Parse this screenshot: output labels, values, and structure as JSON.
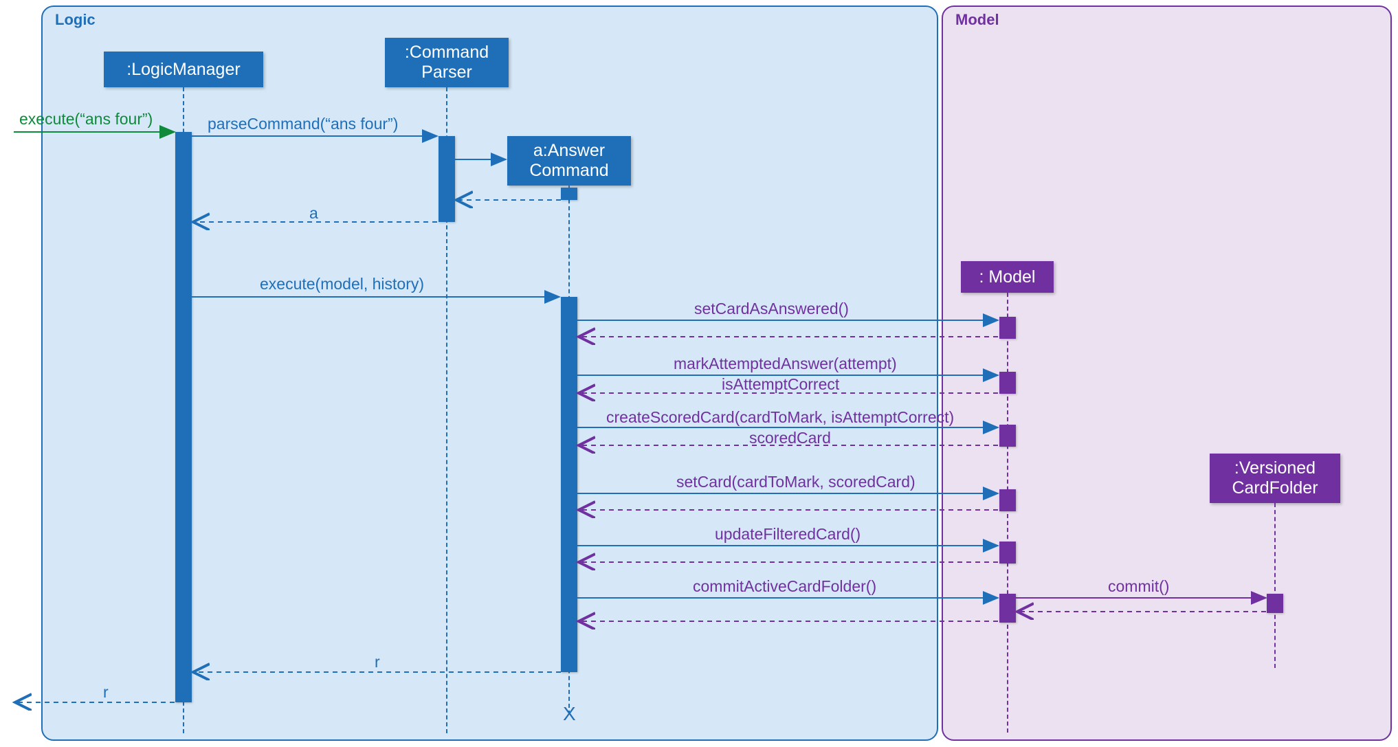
{
  "containers": {
    "logic": {
      "label": "Logic"
    },
    "model": {
      "label": "Model"
    }
  },
  "lifelines": {
    "logicManager": ":LogicManager",
    "commandParser": ":Command\nParser",
    "answerCommand": "a:Answer\nCommand",
    "model": ": Model",
    "versionedCardFolder": ":Versioned\nCardFolder"
  },
  "messages": {
    "executeAnsFour": "execute(“ans four”)",
    "parseCommand": "parseCommand(“ans four”)",
    "returnA": "a",
    "executeModelHistory": "execute(model, history)",
    "setCardAsAnswered": "setCardAsAnswered()",
    "markAttemptedAnswer": "markAttemptedAnswer(attempt)",
    "isAttemptCorrect": "isAttemptCorrect",
    "createScoredCard": "createScoredCard(cardToMark, isAttemptCorrect)",
    "scoredCard": "scoredCard",
    "setCard": "setCard(cardToMark, scoredCard)",
    "updateFilteredCard": "updateFilteredCard()",
    "commitActiveCardFolder": "commitActiveCardFolder()",
    "commit": "commit()",
    "returnR1": "r",
    "returnR2": "r"
  },
  "colors": {
    "logicBg": "#d6e8f7",
    "logicBorder": "#1f6fb8",
    "modelBg": "#ebe1f1",
    "modelBorder": "#7030a0",
    "blue": "#1f6fb8",
    "purple": "#7030a0",
    "green": "#0d8a3a"
  }
}
